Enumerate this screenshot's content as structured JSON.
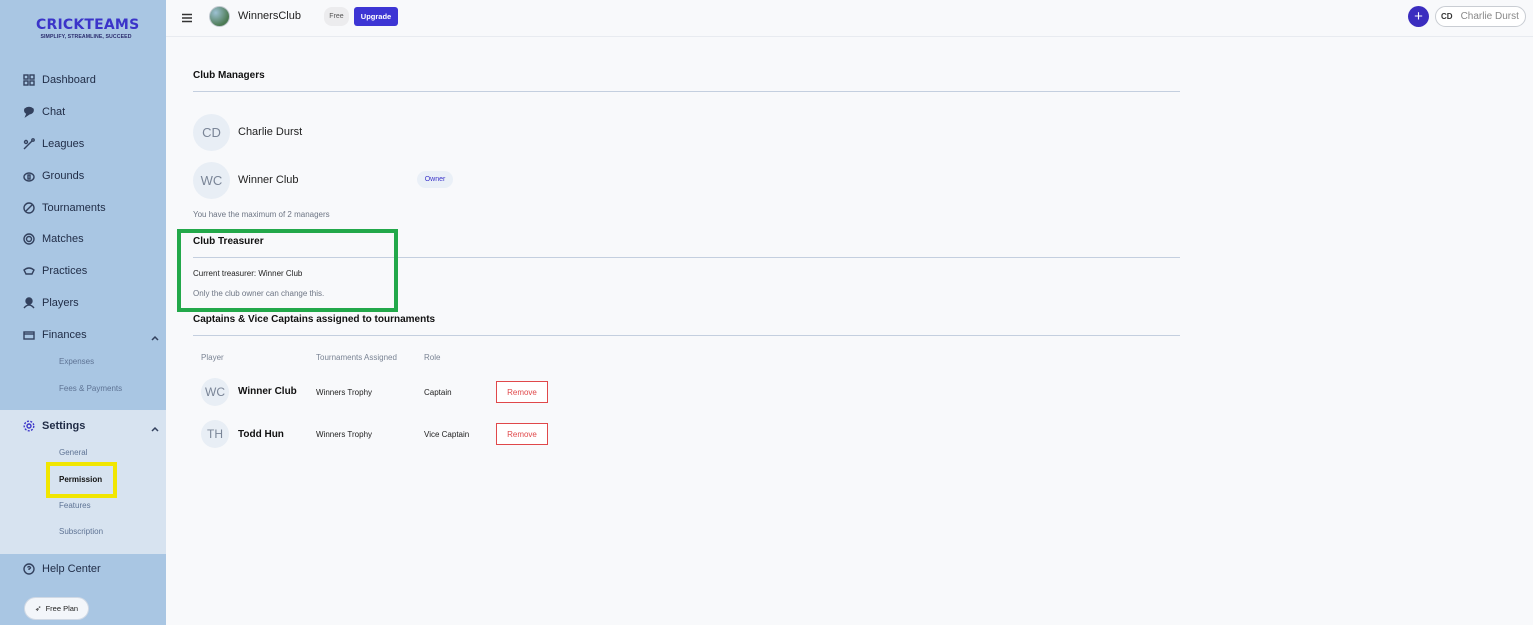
{
  "sidebar": {
    "logo_title": "CRICKTEAMS",
    "logo_tagline": "SIMPLIFY, STREAMLINE, SUCCEED",
    "items": [
      {
        "label": "Dashboard",
        "icon": "dashboard-icon"
      },
      {
        "label": "Chat",
        "icon": "chat-icon"
      },
      {
        "label": "Leagues",
        "icon": "leagues-icon"
      },
      {
        "label": "Grounds",
        "icon": "grounds-icon"
      },
      {
        "label": "Tournaments",
        "icon": "tournaments-icon"
      },
      {
        "label": "Matches",
        "icon": "matches-icon"
      },
      {
        "label": "Practices",
        "icon": "practices-icon"
      },
      {
        "label": "Players",
        "icon": "players-icon"
      },
      {
        "label": "Finances",
        "icon": "finances-icon"
      }
    ],
    "finances_sub": [
      "Expenses",
      "Fees & Payments"
    ],
    "settings": {
      "label": "Settings",
      "sub": [
        "General",
        "Permission",
        "Features",
        "Subscription"
      ],
      "active": "Permission"
    },
    "help_center": "Help Center",
    "free_plan": "Free Plan"
  },
  "topbar": {
    "club_name": "WinnersClub",
    "plan_badge": "Free",
    "upgrade_label": "Upgrade",
    "add_label": "+",
    "user_initials": "CD",
    "user_name": "Charlie Durst"
  },
  "managers": {
    "title": "Club Managers",
    "list": [
      {
        "initials": "CD",
        "name": "Charlie Durst",
        "badge": ""
      },
      {
        "initials": "WC",
        "name": "Winner Club",
        "badge": "Owner"
      }
    ],
    "note": "You have the maximum of 2 managers"
  },
  "treasurer": {
    "title": "Club Treasurer",
    "current": "Current treasurer: Winner Club",
    "note": "Only the club owner can change this."
  },
  "captains": {
    "title": "Captains & Vice Captains assigned to tournaments",
    "columns": [
      "Player",
      "Tournaments Assigned",
      "Role"
    ],
    "rows": [
      {
        "initials": "WC",
        "player": "Winner Club",
        "tournament": "Winners Trophy",
        "role": "Captain",
        "action": "Remove"
      },
      {
        "initials": "TH",
        "player": "Todd Hun",
        "tournament": "Winners Trophy",
        "role": "Vice Captain",
        "action": "Remove"
      }
    ]
  },
  "colors": {
    "accent": "#3b34c9",
    "sidebar_bg": "#a9c6e3",
    "highlight_yellow": "#f1e600",
    "highlight_green": "#22a84a",
    "danger": "#e0484a"
  }
}
